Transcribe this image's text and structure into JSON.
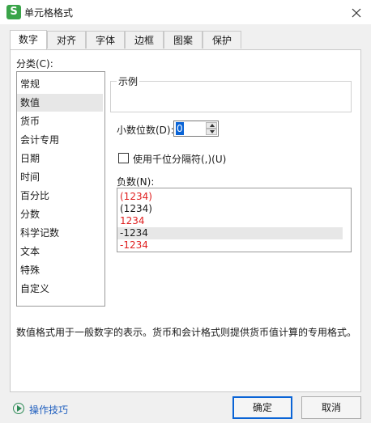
{
  "window": {
    "title": "单元格格式",
    "app_icon": "S"
  },
  "tabs": [
    {
      "label": "数字",
      "active": true
    },
    {
      "label": "对齐",
      "active": false
    },
    {
      "label": "字体",
      "active": false
    },
    {
      "label": "边框",
      "active": false
    },
    {
      "label": "图案",
      "active": false
    },
    {
      "label": "保护",
      "active": false
    }
  ],
  "category": {
    "label": "分类(C):",
    "items": [
      "常规",
      "数值",
      "货币",
      "会计专用",
      "日期",
      "时间",
      "百分比",
      "分数",
      "科学记数",
      "文本",
      "特殊",
      "自定义"
    ],
    "selected_index": 1
  },
  "sample": {
    "legend": "示例"
  },
  "decimal": {
    "label": "小数位数(D):",
    "value": "0"
  },
  "thousands": {
    "label": "使用千位分隔符(,)(U)",
    "checked": false
  },
  "negative": {
    "label": "负数(N):",
    "items": [
      {
        "text": "(1234)",
        "color": "#e02020"
      },
      {
        "text": "(1234)",
        "color": "#1a1a1a"
      },
      {
        "text": "1234",
        "color": "#e02020"
      },
      {
        "text": "-1234",
        "color": "#1a1a1a"
      },
      {
        "text": "-1234",
        "color": "#e02020"
      }
    ],
    "selected_index": 3
  },
  "description": "数值格式用于一般数字的表示。货币和会计格式则提供货币值计算的专用格式。",
  "footer": {
    "help_label": "操作技巧",
    "ok_label": "确定",
    "cancel_label": "取消"
  },
  "colors": {
    "accent": "#0a64d6",
    "negative_red": "#e02020",
    "brand_green": "#3aa449"
  }
}
